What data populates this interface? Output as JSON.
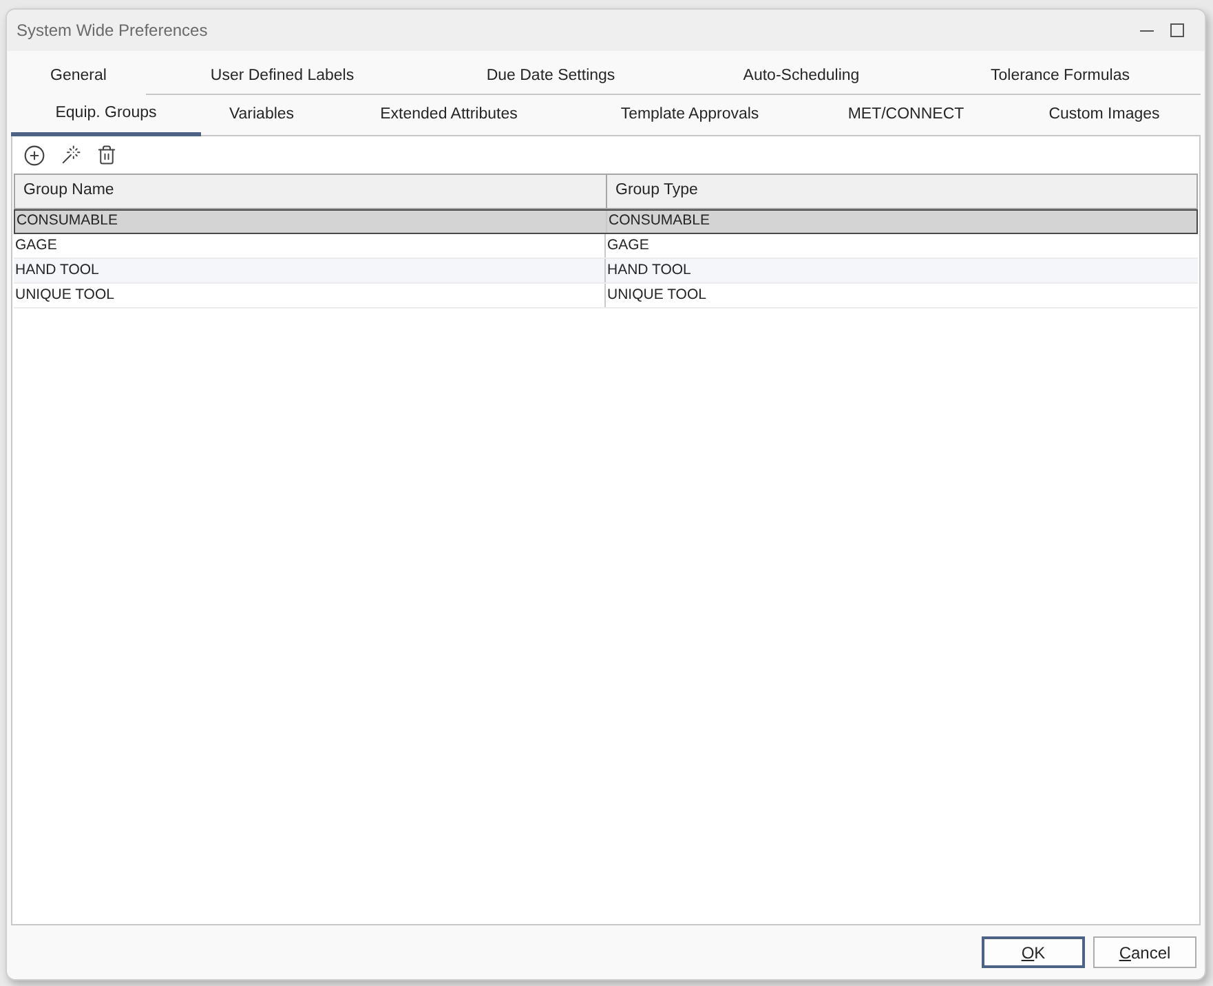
{
  "window": {
    "title": "System Wide Preferences"
  },
  "tab_rows": [
    [
      {
        "label": "General",
        "selected": false
      },
      {
        "label": "User Defined Labels",
        "selected": false
      },
      {
        "label": "Due Date Settings",
        "selected": false
      },
      {
        "label": "Auto-Scheduling",
        "selected": false
      },
      {
        "label": "Tolerance Formulas",
        "selected": false
      }
    ],
    [
      {
        "label": "Equip. Groups",
        "selected": true
      },
      {
        "label": "Variables",
        "selected": false
      },
      {
        "label": "Extended Attributes",
        "selected": false
      },
      {
        "label": "Template Approvals",
        "selected": false
      },
      {
        "label": "MET/CONNECT",
        "selected": false
      },
      {
        "label": "Custom Images",
        "selected": false
      }
    ]
  ],
  "table": {
    "columns": [
      "Group Name",
      "Group Type"
    ],
    "rows": [
      {
        "cells": [
          "CONSUMABLE",
          "CONSUMABLE"
        ],
        "selected": true
      },
      {
        "cells": [
          "GAGE",
          "GAGE"
        ],
        "selected": false
      },
      {
        "cells": [
          "HAND TOOL",
          "HAND TOOL"
        ],
        "selected": false
      },
      {
        "cells": [
          "UNIQUE TOOL",
          "UNIQUE TOOL"
        ],
        "selected": false
      }
    ]
  },
  "buttons": [
    {
      "label_parts": [
        {
          "text": "O",
          "underlined": true
        },
        {
          "text": "K",
          "underlined": false
        }
      ],
      "default": true
    },
    {
      "label_parts": [
        {
          "text": "C",
          "underlined": true
        },
        {
          "text": "ancel",
          "underlined": false
        }
      ],
      "default": false
    }
  ]
}
